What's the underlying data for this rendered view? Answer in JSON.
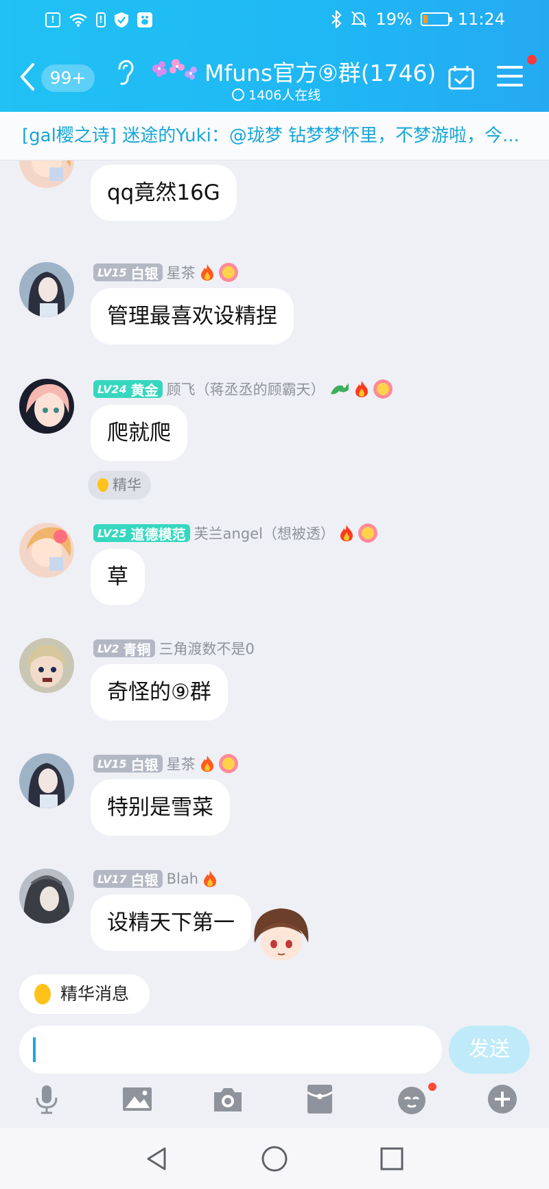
{
  "status_bar": {
    "battery_text": "19%",
    "battery_level": 0.19,
    "time": "11:24",
    "colors": {
      "battery_fill": "#ff9a2b"
    }
  },
  "header": {
    "unread_badge": "99+",
    "group_title": "Mfuns官方⑨群(1746)",
    "online_text": "1406人在线",
    "icons": [
      "back-arrow-icon",
      "ear-icon",
      "flower-decoration-icon",
      "calendar-check-icon",
      "menu-icon"
    ],
    "accent_color": "#21c1f4"
  },
  "notice": {
    "text": "[gal樱之诗] 迷途的Yuki：@珑梦 钻梦梦怀里，不梦游啦，今..."
  },
  "messages": [
    {
      "level": "",
      "rank": "",
      "nickname": "",
      "text": "qq竟然16G"
    },
    {
      "level": "LV15",
      "rank": "白银",
      "nickname": "星茶",
      "text": "管理最喜欢设精捏"
    },
    {
      "level": "LV24",
      "rank": "黄金",
      "nickname": "顾飞（蒋丞丞的顾霸天）",
      "text": "爬就爬",
      "chip": "精华"
    },
    {
      "level": "LV25",
      "rank": "道德模范",
      "nickname": "芙兰angel（想被透）",
      "text": "草"
    },
    {
      "level": "LV2",
      "rank": "青铜",
      "nickname": "三角渡数不是0",
      "text": "奇怪的⑨群"
    },
    {
      "level": "LV15",
      "rank": "白银",
      "nickname": "星茶",
      "text": "特别是雪菜"
    },
    {
      "level": "LV17",
      "rank": "白银",
      "nickname": "Blah",
      "text": "设精天下第一"
    }
  ],
  "essence_button": {
    "label": "精华消息"
  },
  "composer": {
    "send_label": "发送"
  },
  "toolbar": {
    "icons": [
      "microphone-icon",
      "image-icon",
      "camera-icon",
      "red-packet-icon",
      "emoji-icon",
      "plus-icon"
    ]
  },
  "navbar": {
    "icons": [
      "back-triangle-icon",
      "home-circle-icon",
      "recents-square-icon"
    ]
  }
}
